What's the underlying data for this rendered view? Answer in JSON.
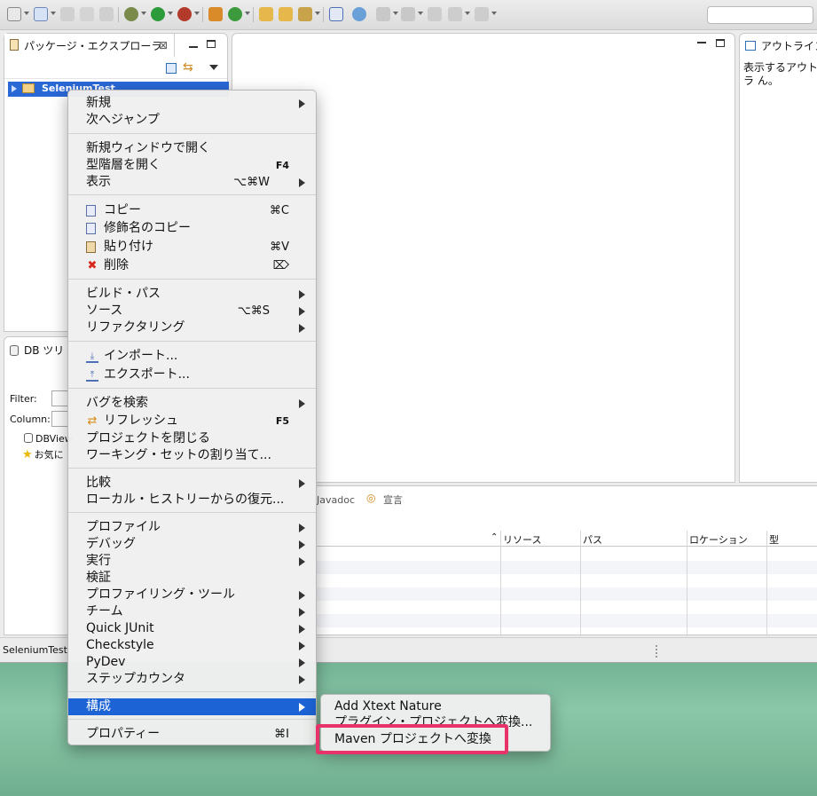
{
  "package_explorer": {
    "tab_title": "パッケージ・エクスプローラ",
    "close_symbol": "⊠",
    "project": "SeleniumTest"
  },
  "outline": {
    "tab_title": "アウトライン",
    "message": "表示するアウトラ ん。"
  },
  "db_tree": {
    "tab_title": "DB ツリ",
    "filter_label": "Filter:",
    "column_label": "Column:",
    "items": [
      "DBView",
      "お気に"
    ]
  },
  "bottom": {
    "tabs": [
      "Javadoc",
      "宣言"
    ],
    "columns": [
      "リソース",
      "パス",
      "ロケーション",
      "型"
    ]
  },
  "status_bar": {
    "text": "SeleniumTest"
  },
  "context_menu": {
    "groups": [
      [
        {
          "label": "新規",
          "submenu": true
        },
        {
          "label": "次へジャンプ"
        }
      ],
      [
        {
          "label": "新規ウィンドウで開く"
        },
        {
          "label": "型階層を開く",
          "shortcut": "F4"
        },
        {
          "label": "表示",
          "shortcut": "⌥⌘W",
          "submenu": true
        }
      ],
      [
        {
          "label": "コピー",
          "shortcut": "⌘C",
          "icon": "copy-icon"
        },
        {
          "label": "修飾名のコピー",
          "icon": "qualified-copy-icon"
        },
        {
          "label": "貼り付け",
          "shortcut": "⌘V",
          "icon": "paste-icon"
        },
        {
          "label": "削除",
          "shortcut": "⌦",
          "icon": "delete-icon"
        }
      ],
      [
        {
          "label": "ビルド・パス",
          "submenu": true
        },
        {
          "label": "ソース",
          "shortcut": "⌥⌘S",
          "submenu": true
        },
        {
          "label": "リファクタリング",
          "submenu": true
        }
      ],
      [
        {
          "label": "インポート...",
          "icon": "import-icon"
        },
        {
          "label": "エクスポート...",
          "icon": "export-icon"
        }
      ],
      [
        {
          "label": "バグを検索",
          "submenu": true
        },
        {
          "label": "リフレッシュ",
          "shortcut": "F5",
          "icon": "refresh-icon"
        },
        {
          "label": "プロジェクトを閉じる"
        },
        {
          "label": "ワーキング・セットの割り当て..."
        }
      ],
      [
        {
          "label": "比較",
          "submenu": true
        },
        {
          "label": "ローカル・ヒストリーからの復元..."
        }
      ],
      [
        {
          "label": "プロファイル",
          "submenu": true
        },
        {
          "label": "デバッグ",
          "submenu": true
        },
        {
          "label": "実行",
          "submenu": true
        },
        {
          "label": "検証"
        },
        {
          "label": "プロファイリング・ツール",
          "submenu": true
        },
        {
          "label": "チーム",
          "submenu": true
        },
        {
          "label": "Quick JUnit",
          "submenu": true
        },
        {
          "label": "Checkstyle",
          "submenu": true
        },
        {
          "label": "PyDev",
          "submenu": true
        },
        {
          "label": "ステップカウンタ",
          "submenu": true
        }
      ],
      [
        {
          "label": "構成",
          "submenu": true,
          "active": true
        }
      ],
      [
        {
          "label": "プロパティー",
          "shortcut": "⌘I"
        }
      ]
    ]
  },
  "submenu": {
    "items": [
      "Add Xtext Nature",
      "プラグイン・プロジェクトへ変換...",
      "Maven プロジェクトへ変換"
    ]
  },
  "colors": {
    "selection": "#1c63d5",
    "highlight_box": "#e8336a",
    "desktop": "#7dbb9b"
  }
}
